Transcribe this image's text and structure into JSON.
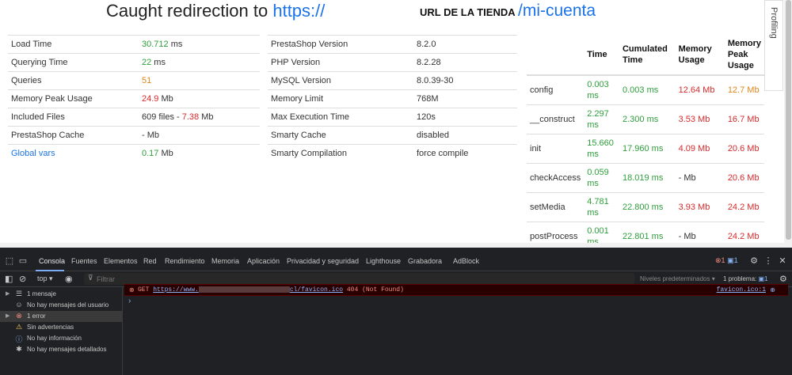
{
  "header": {
    "caught_text": "Caught redirection to ",
    "caught_link": "https://",
    "store_label": "URL DE LA TIENDA",
    "store_path": "/mi-cuenta"
  },
  "perf_table": [
    {
      "label": "Load Time",
      "value": "30.712",
      "unit": " ms"
    },
    {
      "label": "Querying Time",
      "value": "22",
      "unit": " ms"
    },
    {
      "label": "Queries",
      "value": "51",
      "unit": ""
    },
    {
      "label": "Memory Peak Usage",
      "value": "24.9",
      "unit": " Mb"
    },
    {
      "label": "Included Files",
      "value": "609 files - ",
      "value2": "7.38",
      "unit": " Mb"
    },
    {
      "label": "PrestaShop Cache",
      "value": "- Mb",
      "unit": ""
    },
    {
      "label": "Global vars",
      "value": "0.17",
      "unit": " Mb"
    }
  ],
  "env_table": [
    {
      "label": "PrestaShop Version",
      "value": "8.2.0"
    },
    {
      "label": "PHP Version",
      "value": "8.2.28"
    },
    {
      "label": "MySQL Version",
      "value": "8.0.39-30"
    },
    {
      "label": "Memory Limit",
      "value": "768M"
    },
    {
      "label": "Max Execution Time",
      "value": "120s"
    },
    {
      "label": "Smarty Cache",
      "value": "disabled"
    },
    {
      "label": "Smarty Compilation",
      "value": "force compile"
    }
  ],
  "stages_table": {
    "headers": [
      "",
      "Time",
      "Cumulated Time",
      "Memory Usage",
      "Memory Peak Usage"
    ],
    "rows": [
      {
        "name": "config",
        "time": "0.003 ms",
        "cum": "0.003 ms",
        "mem": "12.64 Mb",
        "peak": "12.7 Mb"
      },
      {
        "name": "__construct",
        "time": "2.297 ms",
        "cum": "2.300 ms",
        "mem": "3.53 Mb",
        "peak": "16.7 Mb"
      },
      {
        "name": "init",
        "time": "15.660 ms",
        "cum": "17.960 ms",
        "mem": "4.09 Mb",
        "peak": "20.6 Mb"
      },
      {
        "name": "checkAccess",
        "time": "0.059 ms",
        "cum": "18.019 ms",
        "mem": "- Mb",
        "peak": "20.6 Mb"
      },
      {
        "name": "setMedia",
        "time": "4.781 ms",
        "cum": "22.800 ms",
        "mem": "3.93 Mb",
        "peak": "24.2 Mb"
      },
      {
        "name": "postProcess",
        "time": "0.001 ms",
        "cum": "22.801 ms",
        "mem": "- Mb",
        "peak": "24.2 Mb"
      }
    ]
  },
  "profiling_tab": "Profiling",
  "devtools": {
    "tabs": [
      "Consola",
      "Fuentes",
      "Elementos",
      "Red",
      "Rendimiento",
      "Memoria",
      "Aplicación",
      "Privacidad y seguridad",
      "Lighthouse",
      "Grabadora",
      "AdBlock"
    ],
    "error_count": "1",
    "info_count": "1",
    "context": "top",
    "filter_placeholder": "Filtrar",
    "levels": "Niveles predeterminados",
    "problems_label": "1 problema:",
    "problems_count": "1",
    "sidebar": [
      {
        "icon": "list-icon",
        "label": "1 mensaje"
      },
      {
        "icon": "user-icon",
        "label": "No hay mensajes del usuario"
      },
      {
        "icon": "error-icon",
        "label": "1 error"
      },
      {
        "icon": "warning-icon",
        "label": "Sin advertencias"
      },
      {
        "icon": "info-icon",
        "label": "No hay información"
      },
      {
        "icon": "bug-icon",
        "label": "No hay mensajes detallados"
      }
    ],
    "console_msg": {
      "method": "GET",
      "url_start": "https://www.",
      "url_end": "cl/favicon.ico",
      "status": "404 (Not Found)",
      "source": "favicon.ico:1"
    }
  }
}
